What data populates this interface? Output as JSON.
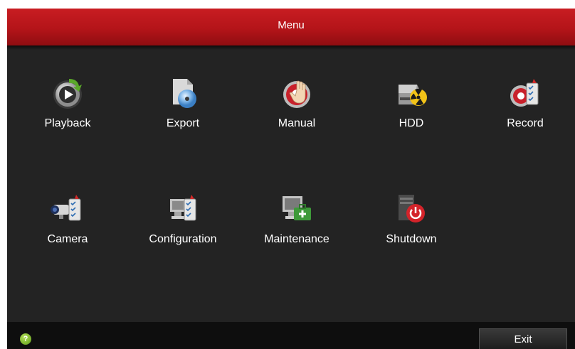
{
  "window": {
    "title": "Menu"
  },
  "menu": {
    "items": [
      {
        "label": "Playback",
        "icon": "playback-icon"
      },
      {
        "label": "Export",
        "icon": "export-icon"
      },
      {
        "label": "Manual",
        "icon": "manual-record-icon"
      },
      {
        "label": "HDD",
        "icon": "hdd-icon"
      },
      {
        "label": "Record",
        "icon": "record-icon"
      },
      {
        "label": "Camera",
        "icon": "camera-icon"
      },
      {
        "label": "Configuration",
        "icon": "configuration-icon"
      },
      {
        "label": "Maintenance",
        "icon": "maintenance-icon"
      },
      {
        "label": "Shutdown",
        "icon": "shutdown-icon"
      }
    ]
  },
  "footer": {
    "help_icon": "help-icon",
    "help_glyph": "?",
    "exit_label": "Exit"
  },
  "colors": {
    "titlebar": "#b41419",
    "background": "#232323",
    "footer": "#0e0e0e",
    "text": "#ffffff"
  }
}
